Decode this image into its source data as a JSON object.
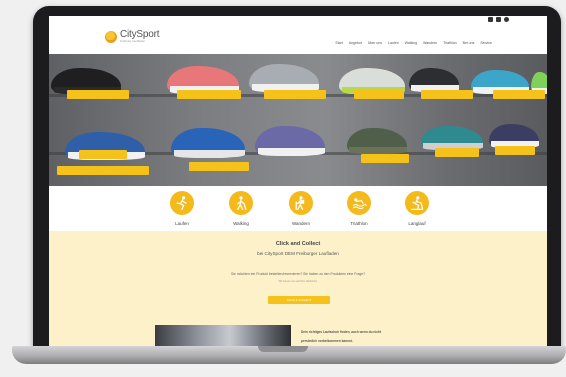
{
  "site": {
    "brand": "CitySport",
    "tagline": "Freiburg Laufladen",
    "nav": [
      "Start",
      "Angebot",
      "Über uns",
      "Laufen",
      "Walking",
      "Wandern",
      "Triathlon",
      "Bei uns",
      "Service"
    ]
  },
  "categories": [
    {
      "label": "Laufen",
      "icon": "runner-icon"
    },
    {
      "label": "Walking",
      "icon": "walker-icon"
    },
    {
      "label": "Wandern",
      "icon": "hiker-icon"
    },
    {
      "label": "Triathlon",
      "icon": "swimmer-icon"
    },
    {
      "label": "Langlauf",
      "icon": "skier-icon"
    }
  ],
  "click_collect": {
    "title": "Click and Collect",
    "subtitle": "bei CitySport DEM Freiburger Laufladen",
    "question": "Sie möchten ein Produkt bestellen/reservieren? Sie haben zu den Produkten eine Frage?",
    "note": "Wir freuen uns auf Ihre Nachricht.",
    "button_label": "CLICK & COLLECT",
    "bottom_line1": "Dein richtiges Laufschuh finden, auch wenn du nicht",
    "bottom_line2": "persönlich vorbeikommen kannst."
  },
  "colors": {
    "accent": "#f4c21a",
    "cream": "#fdf1c9",
    "laptop": "#1c1c1e"
  }
}
